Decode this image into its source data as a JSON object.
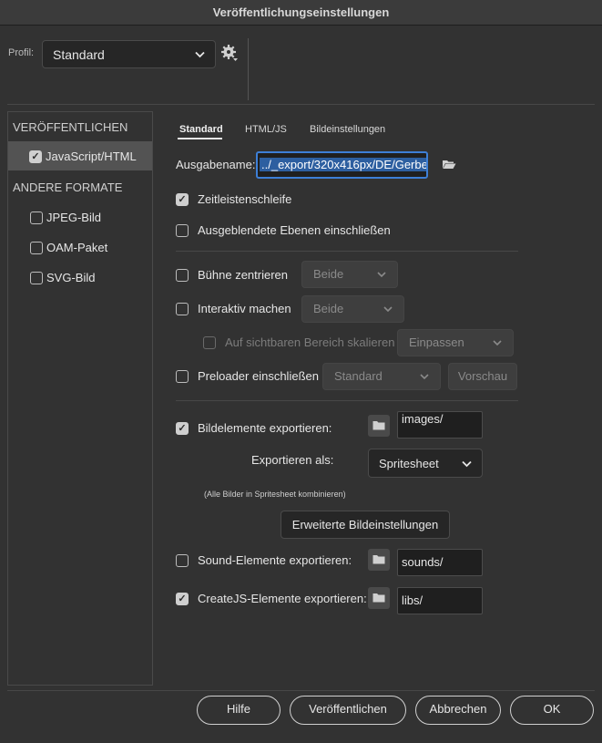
{
  "window": {
    "title": "Veröffentlichungseinstellungen"
  },
  "profile": {
    "label": "Profil:",
    "value": "Standard"
  },
  "sidebar": {
    "header_publish": "VERÖFFENTLICHEN",
    "header_other": "ANDERE FORMATE",
    "items": [
      {
        "label": "JavaScript/HTML",
        "checked": true
      },
      {
        "label": "JPEG-Bild",
        "checked": false
      },
      {
        "label": "OAM-Paket",
        "checked": false
      },
      {
        "label": "SVG-Bild",
        "checked": false
      }
    ]
  },
  "tabs": [
    {
      "label": "Standard"
    },
    {
      "label": "HTML/JS"
    },
    {
      "label": "Bildeinstellungen"
    }
  ],
  "output": {
    "label": "Ausgabename:",
    "value": "../_export/320x416px/DE/Gerbe"
  },
  "options": {
    "loop": {
      "label": "Zeitleistenschleife",
      "checked": true
    },
    "hidden_layers": {
      "label": "Ausgeblendete Ebenen einschließen",
      "checked": false
    },
    "center_stage": {
      "label": "Bühne zentrieren",
      "checked": false,
      "select": "Beide"
    },
    "responsive": {
      "label": "Interaktiv machen",
      "checked": false,
      "select": "Beide"
    },
    "scale_visible": {
      "label": "Auf sichtbaren Bereich skalieren",
      "checked": false,
      "select": "Einpassen"
    },
    "preloader": {
      "label": "Preloader einschließen",
      "checked": false,
      "select": "Standard",
      "preview": "Vorschau"
    }
  },
  "export": {
    "images": {
      "label": "Bildelemente exportieren:",
      "checked": true,
      "path": "images/"
    },
    "export_as": {
      "label": "Exportieren als:",
      "value": "Spritesheet"
    },
    "note": "(Alle Bilder in Spritesheet kombinieren)",
    "advanced_button": "Erweiterte Bildeinstellungen",
    "sounds": {
      "label": "Sound-Elemente exportieren:",
      "checked": false,
      "path": "sounds/"
    },
    "createjs": {
      "label": "CreateJS-Elemente exportieren:",
      "checked": true,
      "path": "libs/"
    }
  },
  "footer": {
    "help": "Hilfe",
    "publish": "Veröffentlichen",
    "cancel": "Abbrechen",
    "ok": "OK"
  },
  "icons": {
    "folder": "folder-icon",
    "gear": "gear-icon",
    "chevron": "chevron-down-icon",
    "check": "checkmark-icon"
  }
}
